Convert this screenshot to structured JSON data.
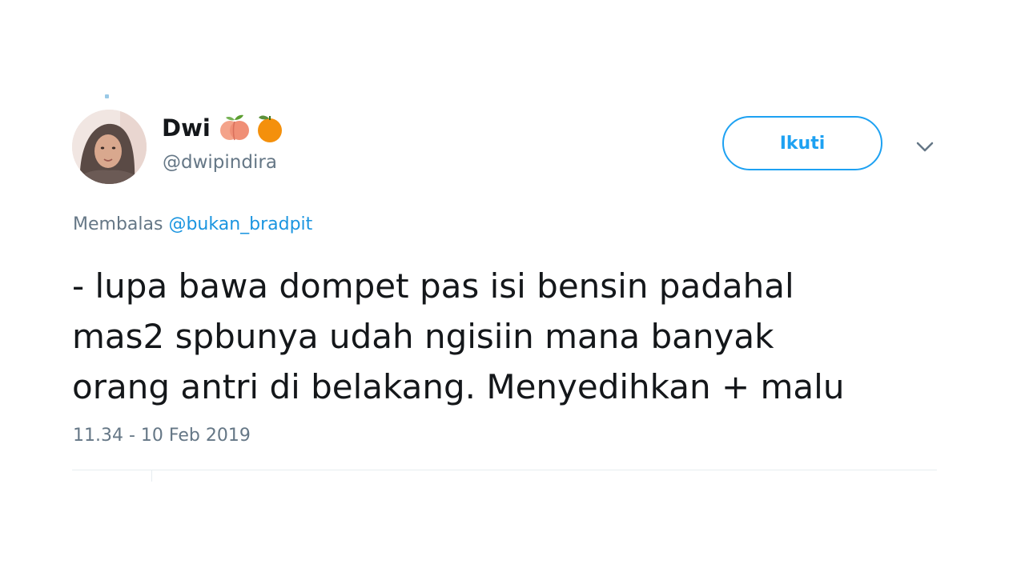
{
  "author": {
    "display_name": "Dwi",
    "handle": "@dwipindira",
    "name_emojis": [
      "peach-icon",
      "tangerine-icon"
    ]
  },
  "actions": {
    "follow_label": "Ikuti",
    "more_icon": "chevron-down-icon"
  },
  "reply": {
    "prefix": "Membalas",
    "mention": "@bukan_bradpit"
  },
  "tweet": {
    "lines": [
      "- lupa bawa dompet pas isi bensin padahal",
      "mas2 spbunya udah ngisiin mana banyak",
      "orang antri di belakang. Menyedihkan + malu"
    ],
    "timestamp": "11.34 - 10 Feb 2019"
  },
  "colors": {
    "accent": "#1da1f2",
    "link": "#1b95e0",
    "secondary_text": "#657786",
    "primary_text": "#14171a"
  }
}
